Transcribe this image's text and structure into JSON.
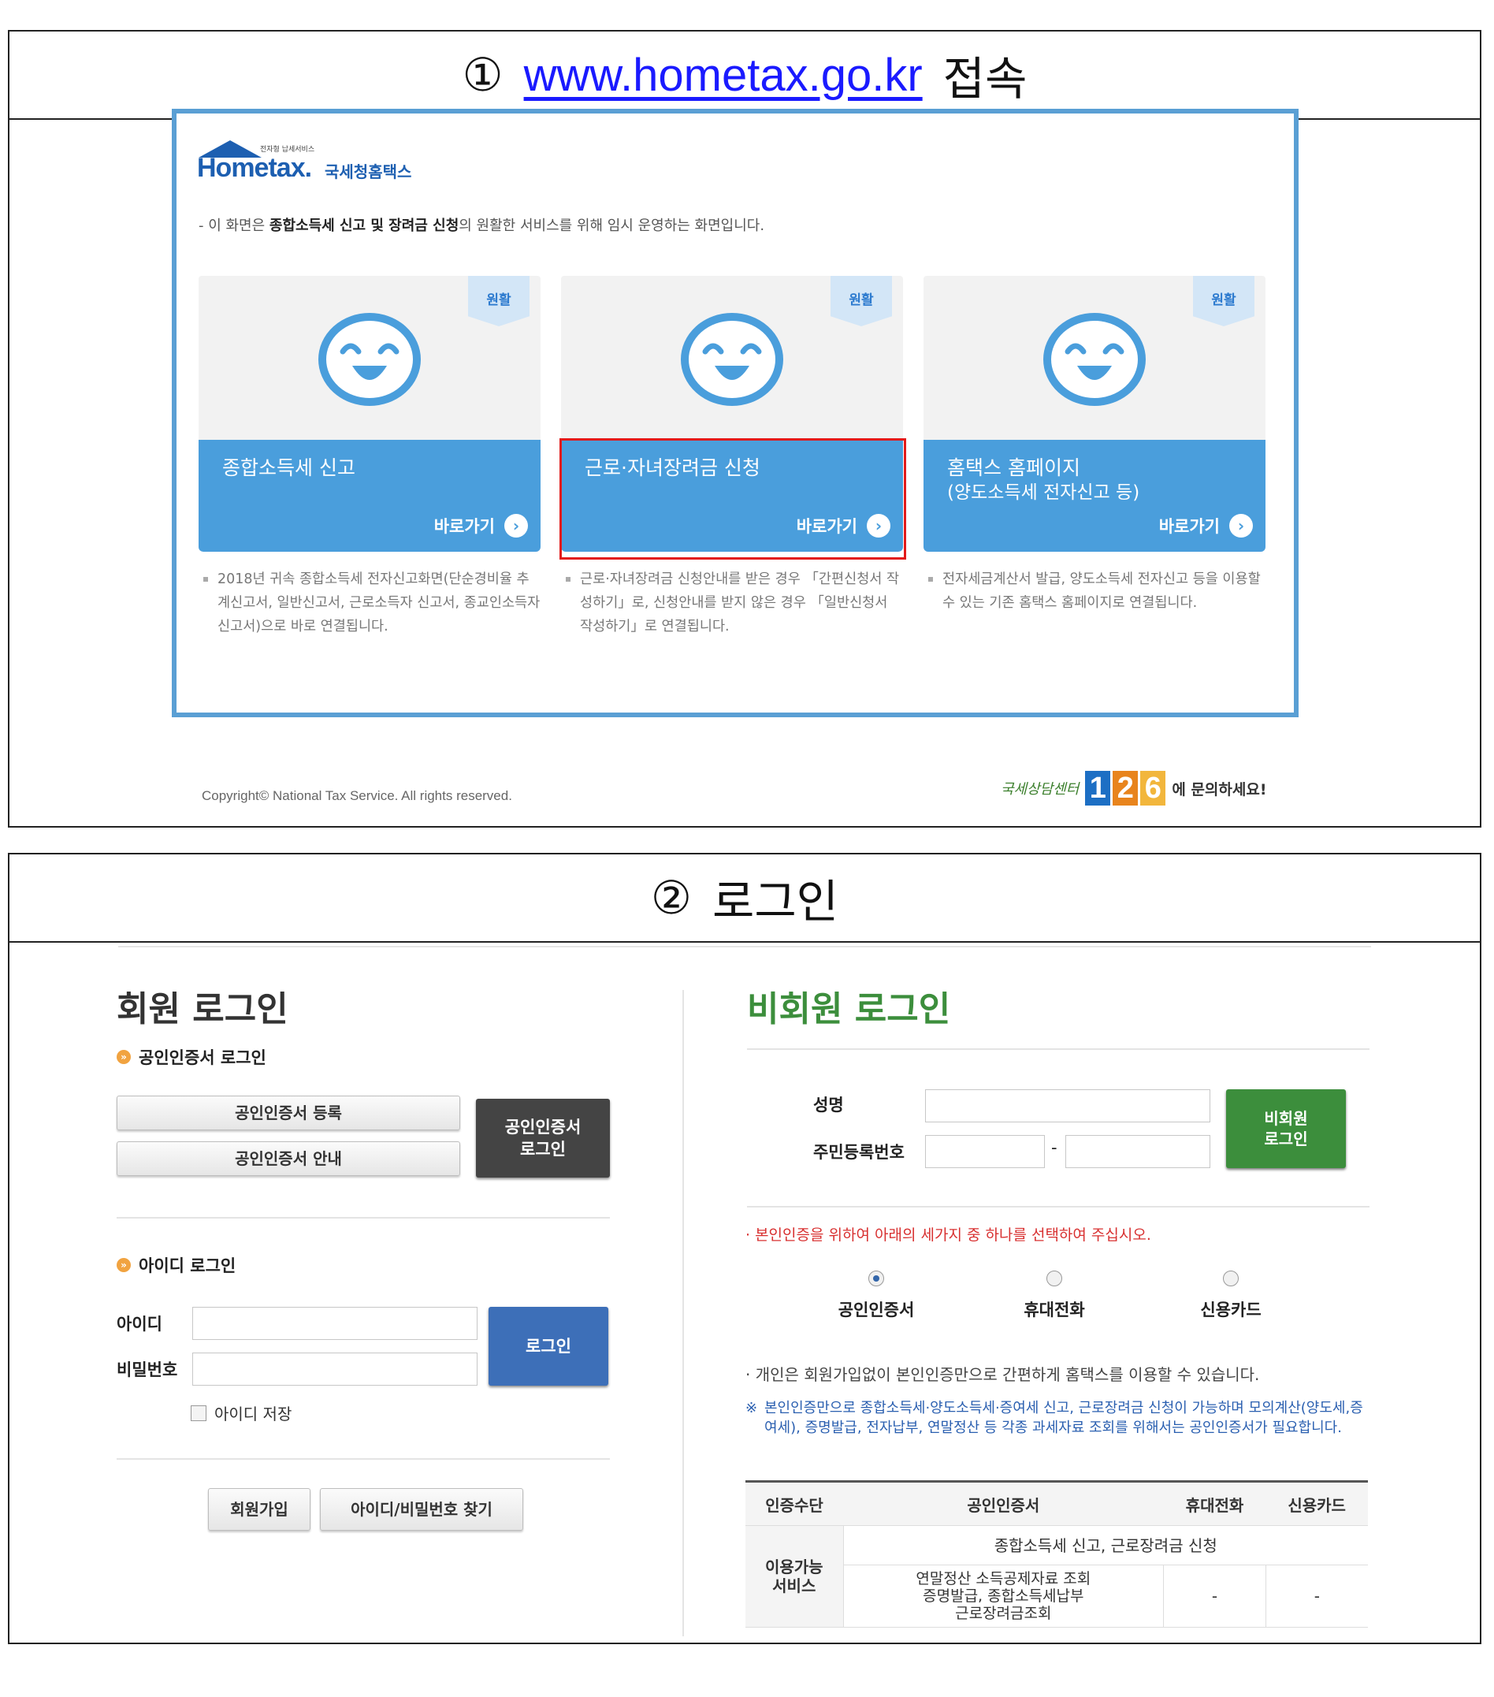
{
  "step1": {
    "number": "①",
    "url": "www.hometax.go.kr",
    "action": "접속"
  },
  "landing": {
    "logo_main": "Hometax.",
    "logo_ko": "국세청홈택스",
    "logo_tagline": "전자형 납세서비스",
    "notice_prefix": "- 이 화면은 ",
    "notice_bold": "종합소득세 신고 및 장려금 신청",
    "notice_suffix": "의 원활한 서비스를 위해 임시 운영하는 화면입니다.",
    "cards": [
      {
        "badge": "원활",
        "title": "종합소득세 신고",
        "subtitle": "",
        "go_label": "바로가기",
        "description": "2018년 귀속 종합소득세 전자신고화면(단순경비율 추계신고서, 일반신고서, 근로소득자 신고서, 종교인소득자 신고서)으로 바로 연결됩니다."
      },
      {
        "badge": "원활",
        "title": "근로·자녀장려금 신청",
        "subtitle": "",
        "go_label": "바로가기",
        "description": "근로·자녀장려금 신청안내를 받은 경우 「간편신청서 작성하기」로, 신청안내를 받지 않은 경우 「일반신청서 작성하기」로 연결됩니다."
      },
      {
        "badge": "원활",
        "title": "홈택스 홈페이지",
        "subtitle": "(양도소득세 전자신고 등)",
        "go_label": "바로가기",
        "description": "전자세금계산서 발급, 양도소득세 전자신고 등을 이용할 수 있는 기존 홈택스 홈페이지로 연결됩니다."
      }
    ],
    "copyright": "Copyright© National Tax Service. All rights reserved.",
    "contact_label": "국세상담센터",
    "contact_digits": [
      "1",
      "2",
      "6"
    ],
    "contact_suffix": "에 문의하세요!",
    "colors": {
      "frame": "#5a9fd4",
      "card": "#4a9edc",
      "highlight": "#e21a1a"
    }
  },
  "step2": {
    "number": "②",
    "action": "로그인"
  },
  "member_login": {
    "title": "회원 로그인",
    "cert_section": "공인인증서 로그인",
    "cert_register": "공인인증서 등록",
    "cert_guide": "공인인증서 안내",
    "cert_login_line1": "공인인증서",
    "cert_login_line2": "로그인",
    "id_section": "아이디 로그인",
    "id_label": "아이디",
    "pw_label": "비밀번호",
    "id_value": "",
    "pw_value": "",
    "login_button": "로그인",
    "save_id": "아이디 저장",
    "join_button": "회원가입",
    "find_button": "아이디/비밀번호 찾기"
  },
  "nonmember_login": {
    "title": "비회원 로그인",
    "name_label": "성명",
    "rrn_label": "주민등록번호",
    "rrn_separator": "-",
    "name_value": "",
    "rrn1_value": "",
    "rrn2_value": "",
    "button_line1": "비회원",
    "button_line2": "로그인",
    "red_note": "· 본인인증을 위하여 아래의 세가지 중 하나를 선택하여 주십시오.",
    "options": [
      {
        "label": "공인인증서",
        "selected": true
      },
      {
        "label": "휴대전화",
        "selected": false
      },
      {
        "label": "신용카드",
        "selected": false
      }
    ],
    "gray_note": "· 개인은 회원가입없이 본인인증만으로 간편하게 홈택스를 이용할 수 있습니다.",
    "blue_note_mark": "※",
    "blue_note": "본인인증만으로 종합소득세·양도소득세·증여세 신고, 근로장려금 신청이 가능하며 모의계산(양도세,증여세), 증명발급, 전자납부, 연말정산 등 각종 과세자료 조회를 위해서는 공인인증서가 필요합니다.",
    "table": {
      "headers": [
        "인증수단",
        "공인인증서",
        "휴대전화",
        "신용카드"
      ],
      "row_head_line1": "이용가능",
      "row_head_line2": "서비스",
      "common_service": "종합소득세 신고, 근로장려금 신청",
      "cert_only_line1": "연말정산 소득공제자료 조회",
      "cert_only_line2": "증명발급, 종합소득세납부",
      "cert_only_line3": "근로장려금조회",
      "phone_only": "-",
      "card_only": "-"
    }
  }
}
